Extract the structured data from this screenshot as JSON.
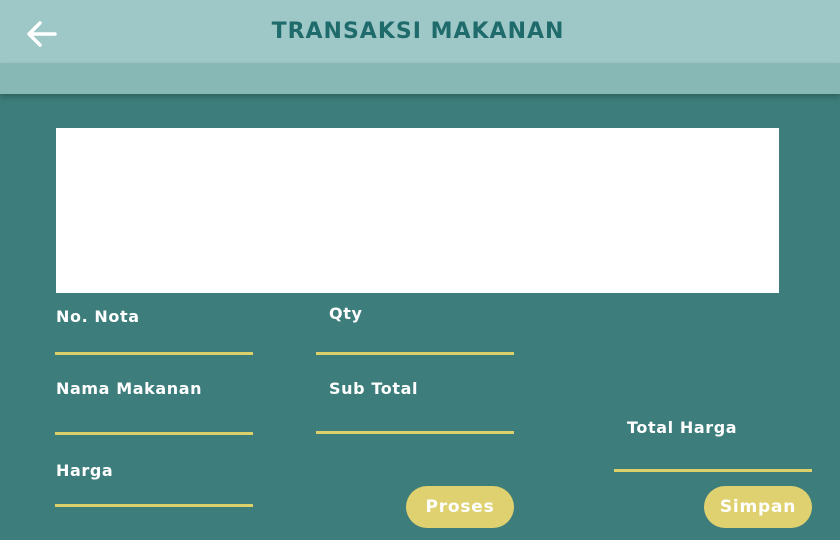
{
  "header": {
    "title": "TRANSAKSI MAKANAN",
    "back_icon": "arrow-left-icon"
  },
  "form": {
    "no_nota": {
      "label": "No. Nota",
      "value": ""
    },
    "qty": {
      "label": "Qty",
      "value": ""
    },
    "nama_makanan": {
      "label": "Nama Makanan",
      "value": ""
    },
    "sub_total": {
      "label": "Sub Total",
      "value": ""
    },
    "total_harga": {
      "label": "Total Harga",
      "value": ""
    },
    "harga": {
      "label": "Harga",
      "value": ""
    }
  },
  "buttons": {
    "proses": "Proses",
    "simpan": "Simpan"
  },
  "colors": {
    "background": "#3d7d7b",
    "appbar": "#9ec8c8",
    "appbar_sub": "#87b8b6",
    "title": "#1f6b6b",
    "accent": "#dcd06a",
    "button": "#dfd170"
  }
}
